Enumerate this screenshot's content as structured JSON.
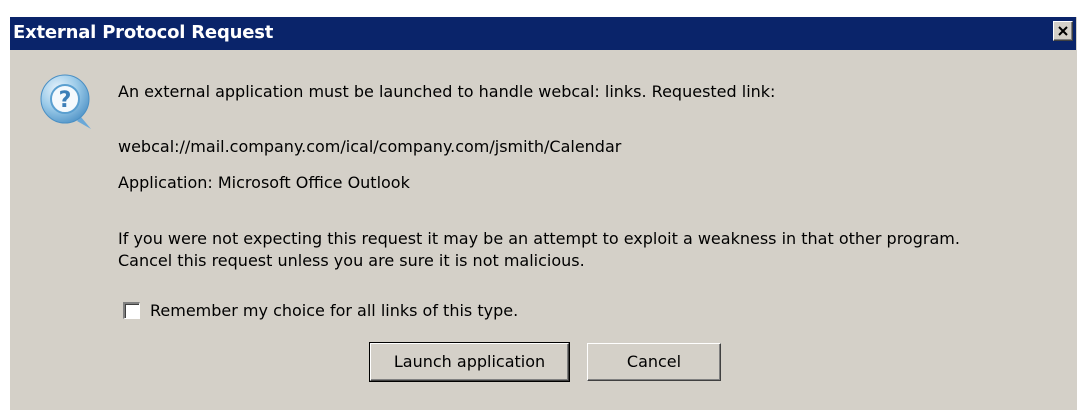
{
  "dialog": {
    "title": "External Protocol Request",
    "message_line1": "An external application must be launched to handle webcal: links. Requested link:",
    "link": "webcal://mail.company.com/ical/company.com/jsmith/Calendar",
    "application": "Application: Microsoft Office Outlook",
    "warning": "If you were not expecting this request it may be an attempt to exploit a weakness in that other program. Cancel this request unless you are sure it is not malicious.",
    "remember_label": "Remember my choice for all links of this type.",
    "remember_checked": false,
    "launch_label": "Launch application",
    "cancel_label": "Cancel",
    "icon": "question-icon"
  },
  "colors": {
    "titlebar": "#0a246a",
    "face": "#d4d0c8",
    "icon_blue": "#5a9fd0"
  }
}
